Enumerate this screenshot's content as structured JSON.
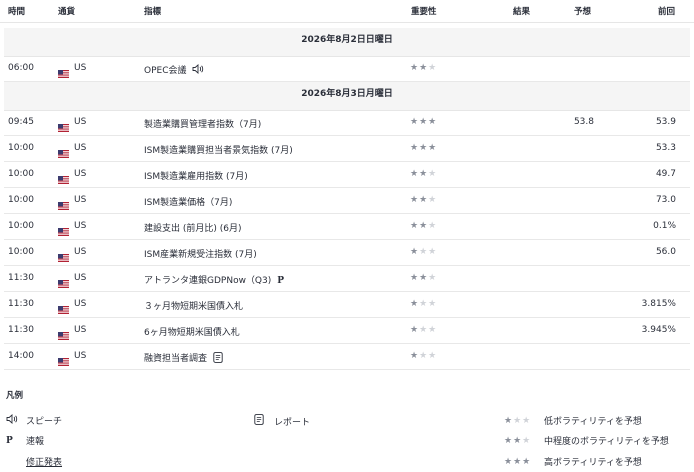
{
  "columns": {
    "time": "時間",
    "currency": "通貨",
    "indicator": "指標",
    "importance": "重要性",
    "actual": "結果",
    "forecast": "予想",
    "previous": "前回"
  },
  "days": [
    {
      "date": "2026年8月2日日曜日",
      "events": [
        {
          "time": "06:00",
          "currency": "US",
          "name": "OPEC会議",
          "icon": "speaker-icon",
          "stars": 2,
          "actual": "",
          "forecast": "",
          "previous": ""
        }
      ]
    },
    {
      "date": "2026年8月3日月曜日",
      "events": [
        {
          "time": "09:45",
          "currency": "US",
          "name": "製造業購買管理者指数（7月)",
          "icon": "",
          "stars": 3,
          "actual": "",
          "forecast": "53.8",
          "previous": "53.9"
        },
        {
          "time": "10:00",
          "currency": "US",
          "name": "ISM製造業購買担当者景気指数 (7月)",
          "icon": "",
          "stars": 3,
          "actual": "",
          "forecast": "",
          "previous": "53.3"
        },
        {
          "time": "10:00",
          "currency": "US",
          "name": "ISM製造業雇用指数 (7月)",
          "icon": "",
          "stars": 2,
          "actual": "",
          "forecast": "",
          "previous": "49.7"
        },
        {
          "time": "10:00",
          "currency": "US",
          "name": "ISM製造業価格（7月)",
          "icon": "",
          "stars": 2,
          "actual": "",
          "forecast": "",
          "previous": "73.0"
        },
        {
          "time": "10:00",
          "currency": "US",
          "name": "建設支出 (前月比) (6月)",
          "icon": "",
          "stars": 2,
          "actual": "",
          "forecast": "",
          "previous": "0.1%"
        },
        {
          "time": "10:00",
          "currency": "US",
          "name": "ISM産業新規受注指数 (7月)",
          "icon": "",
          "stars": 1,
          "actual": "",
          "forecast": "",
          "previous": "56.0"
        },
        {
          "time": "11:30",
          "currency": "US",
          "name": "アトランタ連銀GDPNow（Q3)",
          "icon": "preliminary-icon",
          "stars": 2,
          "actual": "",
          "forecast": "",
          "previous": ""
        },
        {
          "time": "11:30",
          "currency": "US",
          "name": "３ヶ月物短期米国債入札",
          "icon": "",
          "stars": 1,
          "actual": "",
          "forecast": "",
          "previous": "3.815%"
        },
        {
          "time": "11:30",
          "currency": "US",
          "name": "6ヶ月物短期米国債入札",
          "icon": "",
          "stars": 1,
          "actual": "",
          "forecast": "",
          "previous": "3.945%"
        },
        {
          "time": "14:00",
          "currency": "US",
          "name": "融資担当者調査",
          "icon": "report-icon",
          "stars": 1,
          "actual": "",
          "forecast": "",
          "previous": ""
        }
      ]
    }
  ],
  "legend": {
    "title": "凡例",
    "speech": "スピーチ",
    "preliminary_symbol": "P",
    "preliminary": "速報",
    "revised": "修正発表",
    "report": "レポート",
    "low": "低ボラティリティを予想",
    "medium": "中程度のボラティリティを予想",
    "high": "高ボラティリティを予想"
  },
  "colors": {
    "star_active": "#8a8f9a",
    "star_inactive": "#d0d3d8",
    "date_row_bg": "#f5f5f5",
    "text": "#2a2e39"
  }
}
